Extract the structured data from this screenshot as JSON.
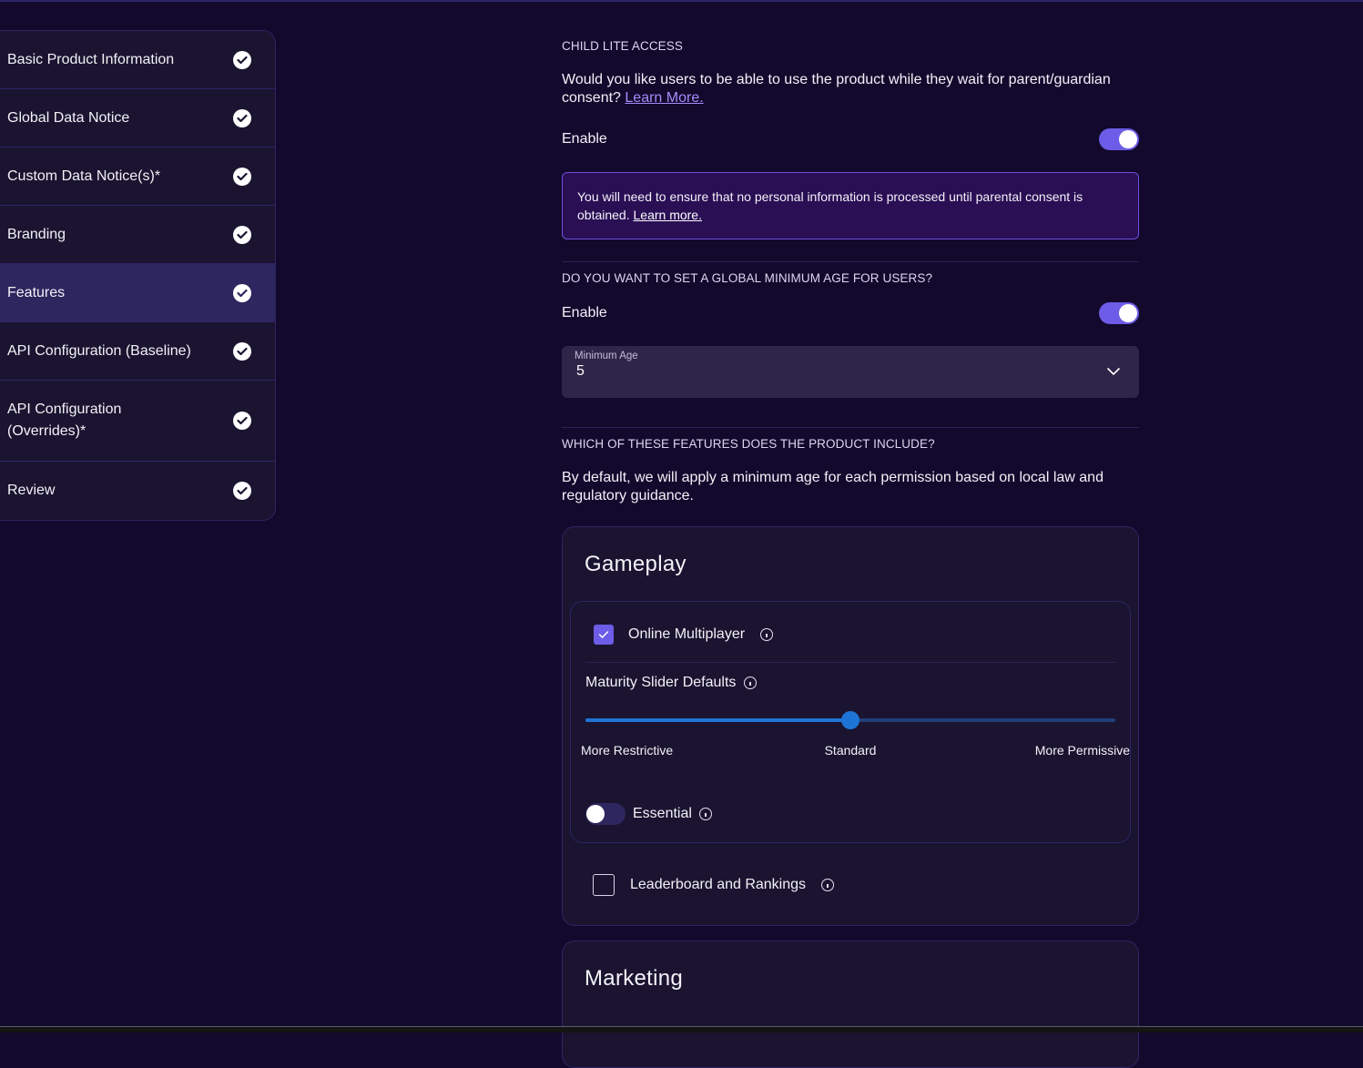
{
  "sidebar": {
    "items": [
      {
        "label": "Basic Product Information",
        "status_icon": "check-circle-icon",
        "active": false
      },
      {
        "label": "Global Data Notice",
        "status_icon": "check-circle-icon",
        "active": false
      },
      {
        "label": "Custom Data Notice(s)*",
        "status_icon": "check-circle-icon",
        "active": false
      },
      {
        "label": "Branding",
        "status_icon": "check-circle-icon",
        "active": false
      },
      {
        "label": "Features",
        "status_icon": "check-circle-icon",
        "active": true
      },
      {
        "label": "API Configuration (Baseline)",
        "status_icon": "check-circle-icon",
        "active": false
      },
      {
        "label": "API Configuration (Overrides)*",
        "status_icon": "check-circle-icon",
        "active": false
      },
      {
        "label": "Review",
        "status_icon": "check-circle-icon",
        "active": false
      }
    ]
  },
  "child_lite": {
    "title": "CHILD LITE ACCESS",
    "description": "Would you like users to be able to use the product while they wait for parent/guardian consent?",
    "learn_more": "Learn More.",
    "enable_label": "Enable",
    "enabled": true,
    "notice_text": "You will need to ensure that no personal information is processed until parental consent is obtained.",
    "notice_link": "Learn more."
  },
  "min_age": {
    "title": "DO YOU WANT TO SET A GLOBAL MINIMUM AGE FOR USERS?",
    "enable_label": "Enable",
    "enabled": true,
    "select_label": "Minimum Age",
    "select_value": "5"
  },
  "features": {
    "title": "WHICH OF THESE FEATURES DOES THE PRODUCT INCLUDE?",
    "description": "By default, we will apply a minimum age for each permission based on local law and regulatory guidance.",
    "categories": [
      {
        "name": "Gameplay",
        "items": [
          {
            "label": "Online Multiplayer",
            "checked": true,
            "maturity_label": "Maturity Slider Defaults",
            "slider": {
              "labels": [
                "More Restrictive",
                "Standard",
                "More Permissive"
              ],
              "value_fraction": 0.5,
              "selected": "Standard"
            },
            "essential_label": "Essential",
            "essential": false
          },
          {
            "label": "Leaderboard and Rankings",
            "checked": false
          }
        ]
      },
      {
        "name": "Marketing"
      }
    ]
  },
  "colors": {
    "accent": "#6c5ce7",
    "slider": "#1e74d6",
    "background": "#13092d",
    "active_nav": "#2e265e"
  }
}
